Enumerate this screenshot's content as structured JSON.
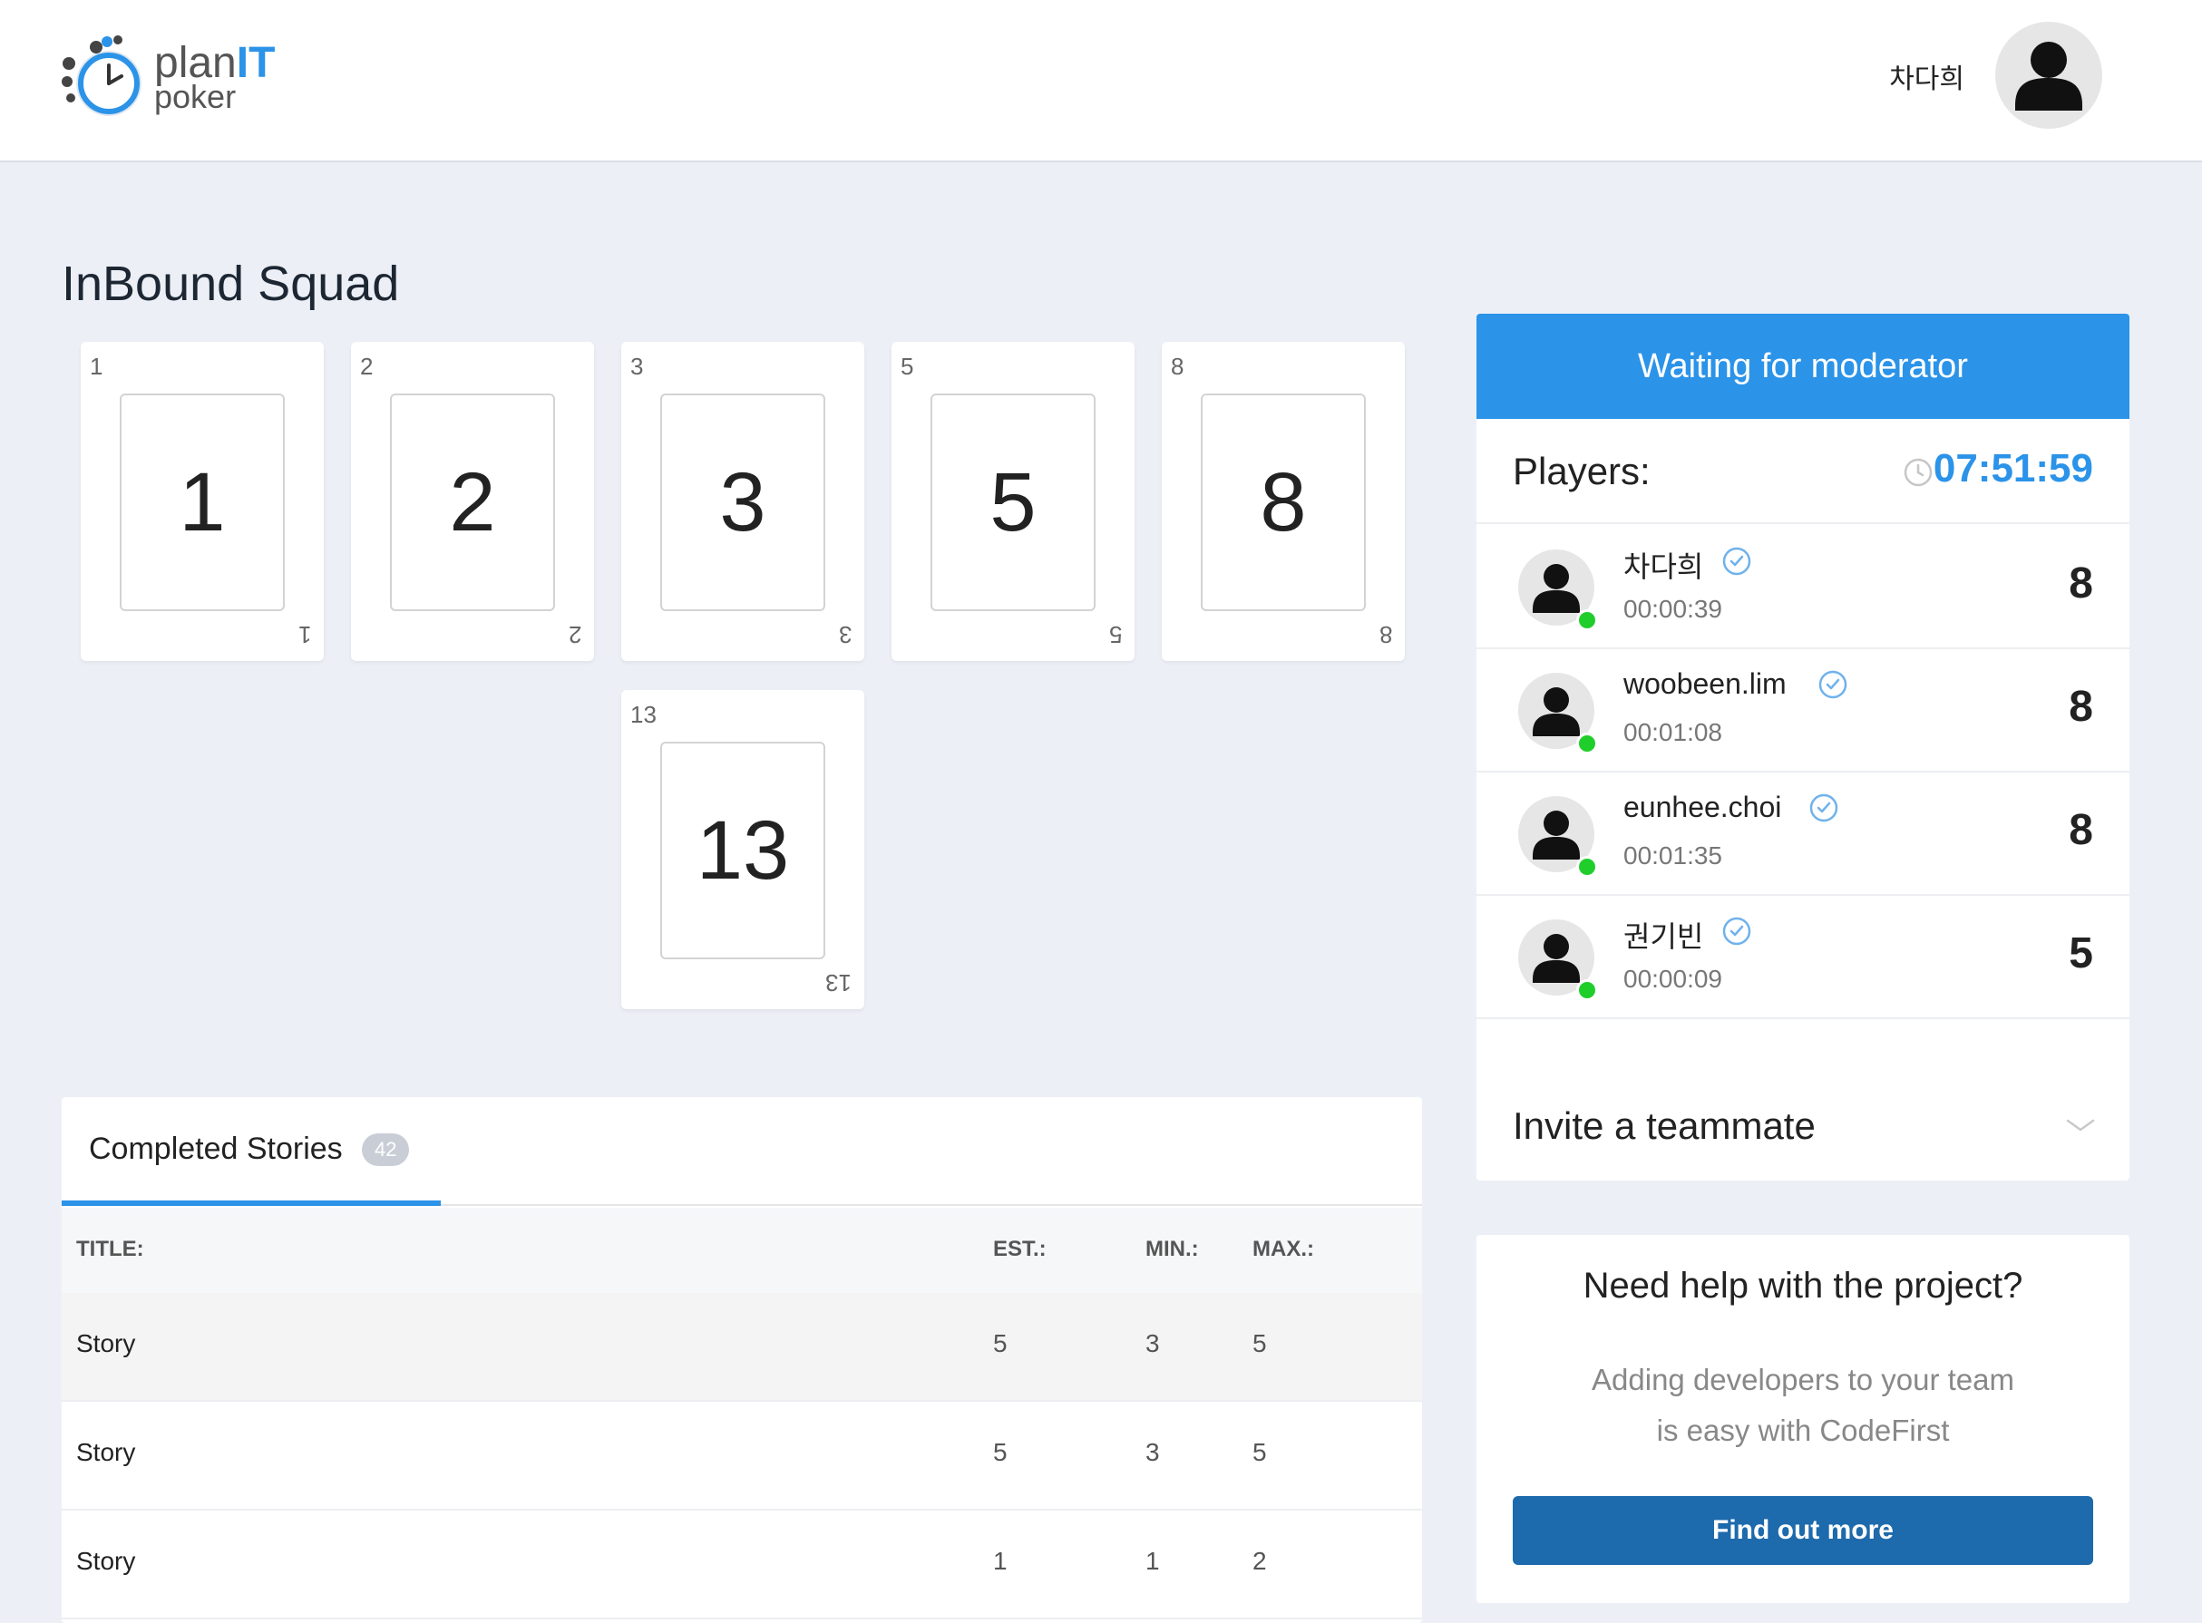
{
  "header": {
    "logo_plan": "plan",
    "logo_it": "IT",
    "logo_poker": "poker",
    "user_name": "차다희",
    "avatar_icon": "user-silhouette-icon"
  },
  "room": {
    "title": "InBound Squad"
  },
  "cards": [
    {
      "value": "1"
    },
    {
      "value": "2"
    },
    {
      "value": "3"
    },
    {
      "value": "5"
    },
    {
      "value": "8"
    },
    {
      "value": "13"
    }
  ],
  "stories": {
    "tab_label": "Completed Stories",
    "count": "42",
    "columns": {
      "title": "TITLE:",
      "est": "EST.:",
      "min": "MIN.:",
      "max": "MAX.:"
    },
    "rows": [
      {
        "title": "Story",
        "est": "5",
        "min": "3",
        "max": "5"
      },
      {
        "title": "Story",
        "est": "5",
        "min": "3",
        "max": "5"
      },
      {
        "title": "Story",
        "est": "1",
        "min": "1",
        "max": "2"
      }
    ]
  },
  "panel": {
    "status": "Waiting for moderator",
    "players_label": "Players:",
    "timer": "07:51:59",
    "players": [
      {
        "name": "차다희",
        "time": "00:00:39",
        "vote": "8"
      },
      {
        "name": "woobeen.lim",
        "time": "00:01:08",
        "vote": "8"
      },
      {
        "name": "eunhee.choi",
        "time": "00:01:35",
        "vote": "8"
      },
      {
        "name": "권기빈",
        "time": "00:00:09",
        "vote": "5"
      }
    ],
    "invite_label": "Invite a teammate"
  },
  "help": {
    "title": "Need help with the project?",
    "line1": "Adding developers to your team",
    "line2": "is easy with CodeFirst",
    "button": "Find out more"
  },
  "colors": {
    "accent": "#2b93e8",
    "button": "#1d6aac",
    "online": "#1fce2a",
    "background": "#ecf0f6"
  }
}
